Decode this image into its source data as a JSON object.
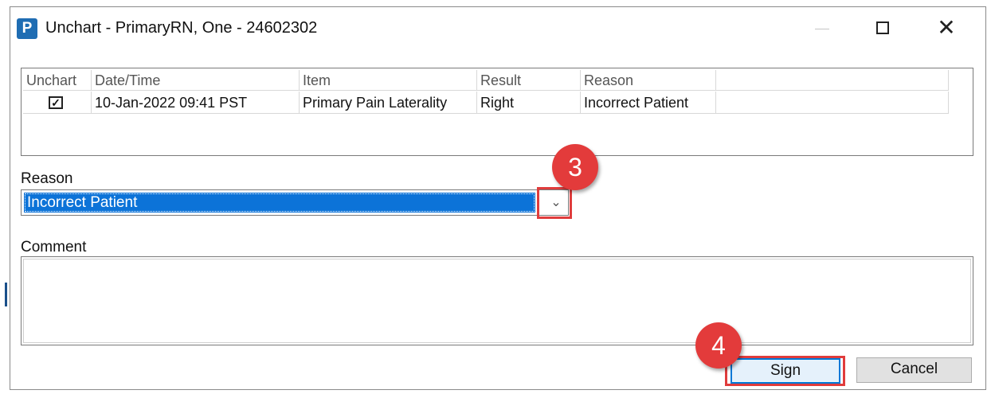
{
  "window": {
    "app_icon_letter": "P",
    "title": "Unchart - PrimaryRN, One - 24602302",
    "controls": {
      "minimize": "minimize",
      "maximize": "maximize",
      "close": "close"
    }
  },
  "grid": {
    "columns": [
      "Unchart",
      "Date/Time",
      "Item",
      "Result",
      "Reason",
      ""
    ],
    "rows": [
      {
        "unchart_checked": true,
        "date_time": "10-Jan-2022 09:41 PST",
        "item": "Primary Pain Laterality",
        "result": "Right",
        "reason": "Incorrect Patient",
        "extra": ""
      }
    ]
  },
  "reason": {
    "label": "Reason",
    "selected": "Incorrect Patient"
  },
  "comment": {
    "label": "Comment",
    "value": ""
  },
  "buttons": {
    "sign": "Sign",
    "cancel": "Cancel"
  },
  "annotations": {
    "step_3": "3",
    "step_4": "4",
    "highlight_color": "#e03c3c"
  },
  "colors": {
    "selection": "#0c73d8",
    "focus_border": "#0078d7",
    "app_icon": "#1f6db3"
  }
}
